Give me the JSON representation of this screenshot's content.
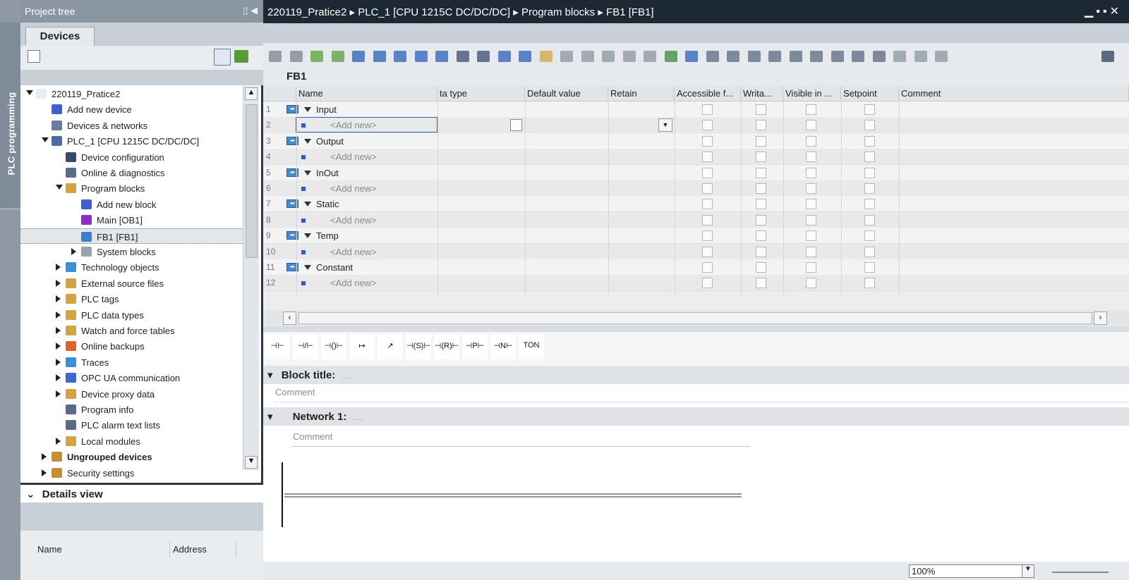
{
  "side_strip": {
    "label": "PLC programming"
  },
  "tree": {
    "header": "Project tree",
    "tab": "Devices",
    "items": [
      {
        "label": "220119_Pratice2",
        "level": 0,
        "expand": "down",
        "icon": "project-icon",
        "color": "#e8ecf8"
      },
      {
        "label": "Add new device",
        "level": 1,
        "expand": "",
        "icon": "add-device-icon",
        "color": "#3f5fd0"
      },
      {
        "label": "Devices & networks",
        "level": 1,
        "expand": "",
        "icon": "network-icon",
        "color": "#6a7ba0"
      },
      {
        "label": "PLC_1 [CPU 1215C DC/DC/DC]",
        "level": 1,
        "expand": "down",
        "icon": "plc-icon",
        "color": "#4a6aa8"
      },
      {
        "label": "Device configuration",
        "level": 2,
        "expand": "",
        "icon": "device-config-icon",
        "color": "#3a4a6a"
      },
      {
        "label": "Online & diagnostics",
        "level": 2,
        "expand": "",
        "icon": "diagnostics-icon",
        "color": "#5a6a8a"
      },
      {
        "label": "Program blocks",
        "level": 2,
        "expand": "down",
        "icon": "folder-icon",
        "color": "#d4a443"
      },
      {
        "label": "Add new block",
        "level": 3,
        "expand": "",
        "icon": "add-block-icon",
        "color": "#3f5fd0"
      },
      {
        "label": "Main [OB1]",
        "level": 3,
        "expand": "",
        "icon": "ob-icon",
        "color": "#8a2fc8"
      },
      {
        "label": "FB1 [FB1]",
        "level": 3,
        "expand": "",
        "icon": "fb-icon",
        "color": "#3a7fd0",
        "selected": true
      },
      {
        "label": "System blocks",
        "level": 3,
        "expand": "right",
        "icon": "system-folder-icon",
        "color": "#9aa3ad"
      },
      {
        "label": "Technology objects",
        "level": 2,
        "expand": "right",
        "icon": "technology-icon",
        "color": "#3a8fd8"
      },
      {
        "label": "External source files",
        "level": 2,
        "expand": "right",
        "icon": "source-file-icon",
        "color": "#d4a443"
      },
      {
        "label": "PLC tags",
        "level": 2,
        "expand": "right",
        "icon": "tags-icon",
        "color": "#d4a443"
      },
      {
        "label": "PLC data types",
        "level": 2,
        "expand": "right",
        "icon": "datatype-icon",
        "color": "#d4a443"
      },
      {
        "label": "Watch and force tables",
        "level": 2,
        "expand": "right",
        "icon": "watch-table-icon",
        "color": "#d4a443"
      },
      {
        "label": "Online backups",
        "level": 2,
        "expand": "right",
        "icon": "backup-icon",
        "color": "#e06030"
      },
      {
        "label": "Traces",
        "level": 2,
        "expand": "right",
        "icon": "trace-icon",
        "color": "#3a8fd8"
      },
      {
        "label": "OPC UA communication",
        "level": 2,
        "expand": "right",
        "icon": "opcua-icon",
        "color": "#3a6ad0"
      },
      {
        "label": "Device proxy data",
        "level": 2,
        "expand": "right",
        "icon": "proxy-icon",
        "color": "#d4a443"
      },
      {
        "label": "Program info",
        "level": 2,
        "expand": "",
        "icon": "program-info-icon",
        "color": "#5a6a8a"
      },
      {
        "label": "PLC alarm text lists",
        "level": 2,
        "expand": "",
        "icon": "alarm-text-icon",
        "color": "#5a6a8a"
      },
      {
        "label": "Local modules",
        "level": 2,
        "expand": "right",
        "icon": "modules-icon",
        "color": "#d4a443"
      },
      {
        "label": "Ungrouped devices",
        "level": 1,
        "expand": "right",
        "icon": "ungrouped-icon",
        "color": "#c49030",
        "bold": true
      },
      {
        "label": "Security settings",
        "level": 1,
        "expand": "right",
        "icon": "security-icon",
        "color": "#c49030"
      }
    ]
  },
  "details": {
    "header": "Details view",
    "col_name": "Name",
    "col_address": "Address"
  },
  "editor": {
    "breadcrumb": [
      "220119_Pratice2",
      "PLC_1 [CPU 1215C DC/DC/DC]",
      "Program blocks",
      "FB1 [FB1]"
    ],
    "block_name": "FB1",
    "columns": [
      "Name",
      "ta type",
      "Default value",
      "Retain",
      "Accessible f...",
      "Writa...",
      "Visible in ...",
      "Setpoint",
      "Comment"
    ],
    "rows": [
      {
        "n": "1",
        "name": "Input",
        "section": true
      },
      {
        "n": "2",
        "name": "<Add new>",
        "section": false,
        "editing": true
      },
      {
        "n": "3",
        "name": "Output",
        "section": true
      },
      {
        "n": "4",
        "name": "<Add new>",
        "section": false
      },
      {
        "n": "5",
        "name": "InOut",
        "section": true
      },
      {
        "n": "6",
        "name": "<Add new>",
        "section": false
      },
      {
        "n": "7",
        "name": "Static",
        "section": true
      },
      {
        "n": "8",
        "name": "<Add new>",
        "section": false
      },
      {
        "n": "9",
        "name": "Temp",
        "section": true
      },
      {
        "n": "10",
        "name": "<Add new>",
        "section": false
      },
      {
        "n": "11",
        "name": "Constant",
        "section": true
      },
      {
        "n": "12",
        "name": "<Add new>",
        "section": false
      }
    ],
    "palette": [
      "⊣⊢",
      "⊣/⊢",
      "⊣()⊢",
      "↦",
      "↗",
      "⊣(S)⊢",
      "⊣(R)⊢",
      "⊣P⊢",
      "⊣N⊢",
      "TON"
    ],
    "block_title": "Block title:",
    "block_title_dots": ".....",
    "block_comment": "Comment",
    "network_title": "Network 1:",
    "network_dots": ".....",
    "network_comment": "Comment",
    "zoom": "100%"
  }
}
